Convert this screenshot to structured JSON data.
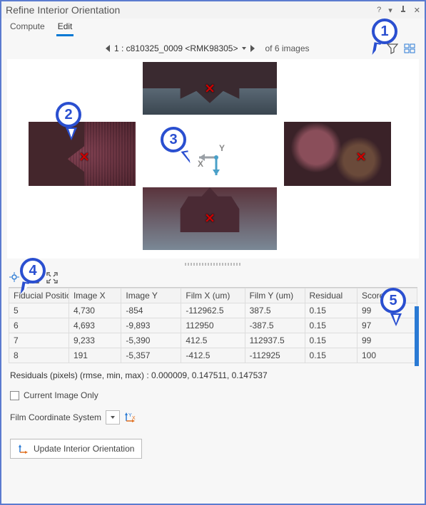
{
  "title": "Refine Interior Orientation",
  "tabs": {
    "compute": "Compute",
    "edit": "Edit"
  },
  "nav": {
    "image_label": "1 : c810325_0009 <RMK98305>",
    "of_images": "of 6 images"
  },
  "axes": {
    "x": "X",
    "y": "Y"
  },
  "annotations": {
    "a1": "1",
    "a2": "2",
    "a3": "3",
    "a4": "4",
    "a5": "5"
  },
  "table": {
    "headers": {
      "fp": "Fiducial Positio",
      "ix": "Image X",
      "iy": "Image Y",
      "fx": "Film X (um)",
      "fy": "Film Y (um)",
      "res": "Residual",
      "score": "Score"
    },
    "rows": [
      {
        "fp": "5",
        "ix": "4,730",
        "iy": "-854",
        "fx": "-112962.5",
        "fy": "387.5",
        "res": "0.15",
        "score": "99"
      },
      {
        "fp": "6",
        "ix": "4,693",
        "iy": "-9,893",
        "fx": "112950",
        "fy": "-387.5",
        "res": "0.15",
        "score": "97"
      },
      {
        "fp": "7",
        "ix": "9,233",
        "iy": "-5,390",
        "fx": "412.5",
        "fy": "112937.5",
        "res": "0.15",
        "score": "99"
      },
      {
        "fp": "8",
        "ix": "191",
        "iy": "-5,357",
        "fx": "-412.5",
        "fy": "-112925",
        "res": "0.15",
        "score": "100"
      }
    ]
  },
  "residuals_label": "Residuals (pixels) (rmse, min, max)  : 0.000009, 0.147511, 0.147537",
  "current_image_only": "Current Image Only",
  "film_cs_label": "Film Coordinate System",
  "update_btn": "Update Interior Orientation"
}
